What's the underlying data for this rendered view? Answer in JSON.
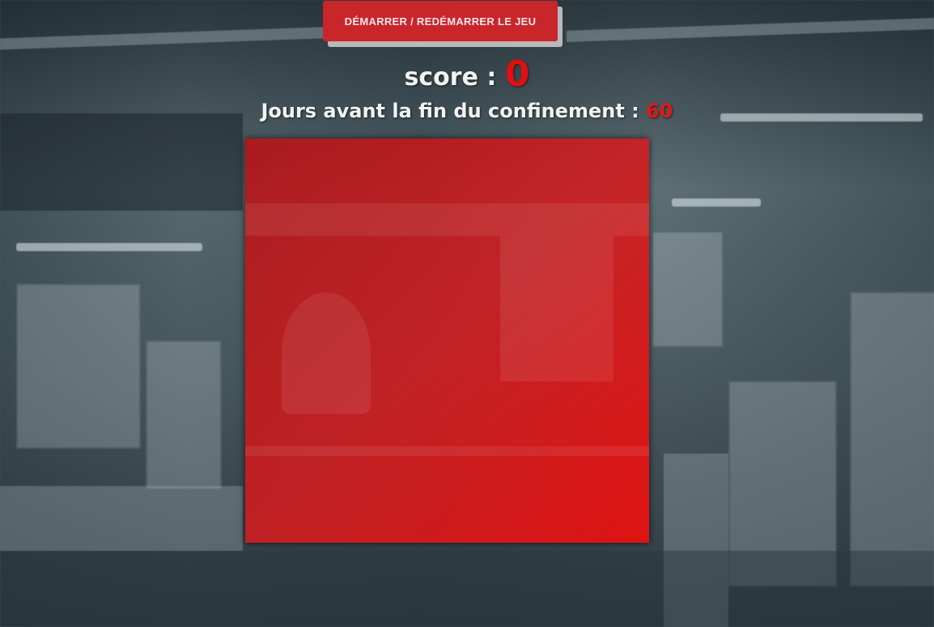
{
  "controls": {
    "start_label": "DÉMARRER / REDÉMARRER LE JEU"
  },
  "score": {
    "label": "score : ",
    "value": "0"
  },
  "countdown": {
    "label": "Jours avant la fin du confinement : ",
    "value": "60"
  },
  "colors": {
    "accent": "#c9262c",
    "board": "#d41c1e",
    "value_red": "#e01010"
  }
}
